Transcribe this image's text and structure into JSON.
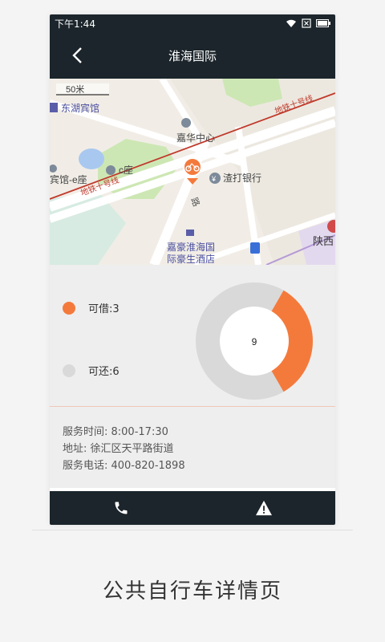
{
  "status_bar": {
    "time": "下午1:44"
  },
  "header": {
    "title": "淮海国际"
  },
  "map": {
    "scale_label": "50米",
    "labels": {
      "donghu": "东湖宾馆",
      "jiahua": "嘉华中心",
      "eseat": "宾馆-e座",
      "cseat": "c座",
      "bank": "渣打银行",
      "hotel_l1": "嘉豪淮海国",
      "hotel_l2": "际豪生酒店",
      "shaanxi": "陕西",
      "metro_a": "地铁十号线",
      "metro_b": "地铁十号线",
      "road": "路",
      "yen": "¥"
    }
  },
  "availability": {
    "borrow_label": "可借:3",
    "return_label": "可还:6",
    "total": "9",
    "borrow": 3,
    "return": 6,
    "colors": {
      "borrow": "#f47a3c",
      "return": "#d9d9d9"
    }
  },
  "details": {
    "hours": "服务时间:  8:00-17:30",
    "address": "地址:  徐汇区天平路街道",
    "phone": "服务电话:  400-820-1898"
  },
  "bottom": {
    "call_icon": "phone-icon",
    "report_icon": "warning-icon"
  },
  "caption": "公共自行车详情页"
}
